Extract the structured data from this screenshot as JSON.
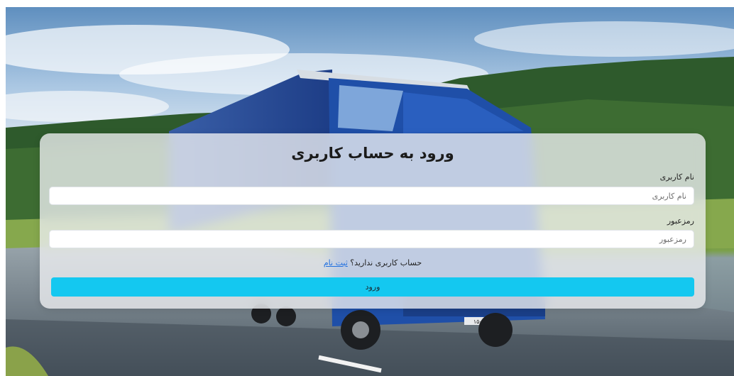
{
  "login": {
    "title": "ورود به حساب کاربری",
    "username_label": "نام کاربری",
    "username_placeholder": "نام کاربری",
    "password_label": "رمزعبور",
    "password_placeholder": "رمزعبور",
    "no_account_text": "حساب کاربری ندارید؟",
    "register_link": "ثبت نام",
    "submit_label": "ورود"
  },
  "background": {
    "truck_plate": "۱۵-۵۸۷"
  },
  "colors": {
    "button": "#14c8f0",
    "link": "#1f6fe0",
    "card": "#eef0f2"
  }
}
